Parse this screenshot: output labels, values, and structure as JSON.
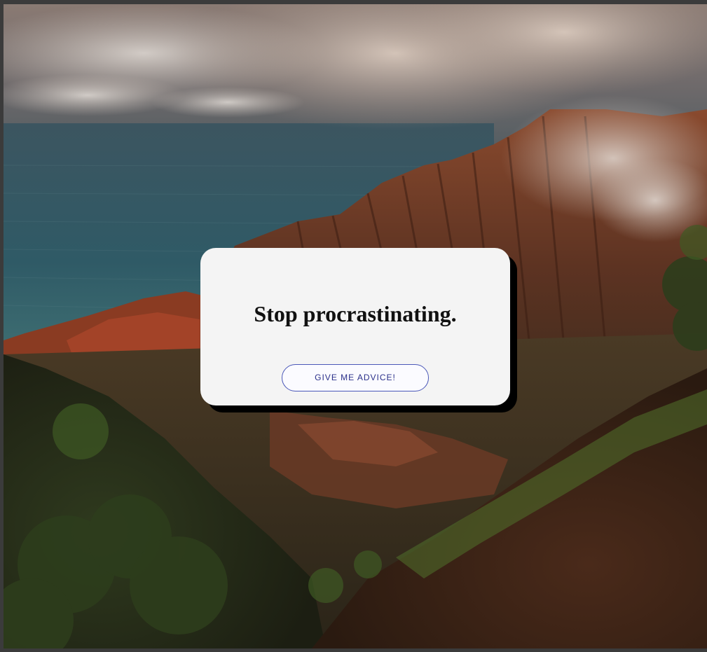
{
  "card": {
    "title": "Stop procrastinating.",
    "button_label": "GIVE ME ADVICE!"
  },
  "background": {
    "image_icon": "mountain-coast-photo"
  },
  "colors": {
    "card_background": "#f4f4f4",
    "card_shadow": "#000000",
    "button_border": "#4a57b8",
    "button_text": "#2a2f8a"
  }
}
